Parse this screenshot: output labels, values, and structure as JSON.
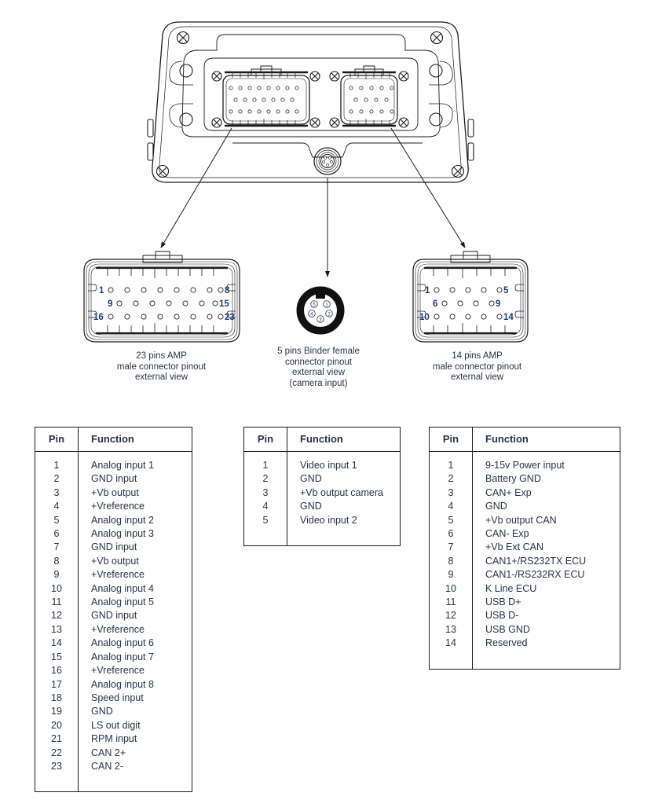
{
  "diagram": {
    "device": {
      "name": "dashboard-logger-rear-view",
      "connectors": [
        {
          "id": "conn-23",
          "position": "left"
        },
        {
          "id": "conn-5",
          "position": "center-bottom"
        },
        {
          "id": "conn-14",
          "position": "right"
        }
      ]
    },
    "callouts": [
      {
        "id": "callout-23",
        "caption": "23 pins AMP\nmale connector pinout\nexternal view",
        "pin_rows": [
          {
            "start_label": "1",
            "end_label": "8",
            "count": 8
          },
          {
            "start_label": "9",
            "end_label": "15",
            "count": 7
          },
          {
            "start_label": "16",
            "end_label": "23",
            "count": 8
          }
        ]
      },
      {
        "id": "callout-5",
        "caption": "5 pins Binder female\nconnector pinout\nexternal view\n(camera input)",
        "pin_labels": [
          "1",
          "2",
          "3",
          "4",
          "5"
        ]
      },
      {
        "id": "callout-14",
        "caption": "14 pins AMP\nmale connector pinout\nexternal view",
        "pin_rows": [
          {
            "start_label": "1",
            "end_label": "5",
            "count": 5
          },
          {
            "start_label": "6",
            "end_label": "9",
            "count": 4
          },
          {
            "start_label": "10",
            "end_label": "14",
            "count": 5
          }
        ]
      }
    ]
  },
  "tables": {
    "headers": {
      "pin": "Pin",
      "function": "Function"
    },
    "connector_23": {
      "rows": [
        {
          "pin": "1",
          "function": "Analog input 1"
        },
        {
          "pin": "2",
          "function": "GND input"
        },
        {
          "pin": "3",
          "function": "+Vb output"
        },
        {
          "pin": "4",
          "function": "+Vreference"
        },
        {
          "pin": "5",
          "function": "Analog input 2"
        },
        {
          "pin": "6",
          "function": "Analog input 3"
        },
        {
          "pin": "7",
          "function": "GND input"
        },
        {
          "pin": "8",
          "function": "+Vb output"
        },
        {
          "pin": "9",
          "function": "+Vreference"
        },
        {
          "pin": "10",
          "function": "Analog input 4"
        },
        {
          "pin": "11",
          "function": "Analog input 5"
        },
        {
          "pin": "12",
          "function": "GND input"
        },
        {
          "pin": "13",
          "function": "+Vreference"
        },
        {
          "pin": "14",
          "function": "Analog input 6"
        },
        {
          "pin": "15",
          "function": "Analog input 7"
        },
        {
          "pin": "16",
          "function": "+Vreference"
        },
        {
          "pin": "17",
          "function": "Analog input 8"
        },
        {
          "pin": "18",
          "function": "Speed input"
        },
        {
          "pin": "19",
          "function": "GND"
        },
        {
          "pin": "20",
          "function": "LS out digit"
        },
        {
          "pin": "21",
          "function": "RPM input"
        },
        {
          "pin": "22",
          "function": "CAN 2+"
        },
        {
          "pin": "23",
          "function": "CAN 2-"
        }
      ]
    },
    "connector_5": {
      "rows": [
        {
          "pin": "1",
          "function": "Video input 1"
        },
        {
          "pin": "2",
          "function": "GND"
        },
        {
          "pin": "3",
          "function": "+Vb output camera"
        },
        {
          "pin": "4",
          "function": "GND"
        },
        {
          "pin": "5",
          "function": "Video input 2"
        }
      ]
    },
    "connector_14": {
      "rows": [
        {
          "pin": "1",
          "function": "9-15v Power input"
        },
        {
          "pin": "2",
          "function": "Battery GND"
        },
        {
          "pin": "3",
          "function": "CAN+ Exp"
        },
        {
          "pin": "4",
          "function": "GND"
        },
        {
          "pin": "5",
          "function": "+Vb output CAN"
        },
        {
          "pin": "6",
          "function": "CAN- Exp"
        },
        {
          "pin": "7",
          "function": "+Vb Ext CAN"
        },
        {
          "pin": "8",
          "function": "CAN1+/RS232TX ECU"
        },
        {
          "pin": "9",
          "function": "CAN1-/RS232RX ECU"
        },
        {
          "pin": "10",
          "function": "K Line ECU"
        },
        {
          "pin": "11",
          "function": "USB D+"
        },
        {
          "pin": "12",
          "function": "USB D-"
        },
        {
          "pin": "13",
          "function": "USB GND"
        },
        {
          "pin": "14",
          "function": "Reserved"
        }
      ]
    }
  },
  "colors": {
    "line": "#1b1b1b",
    "text": "#2a3244",
    "pin_label": "#1d3c6e",
    "shell_fill": "#ffffff",
    "binder_body": "#111111"
  }
}
